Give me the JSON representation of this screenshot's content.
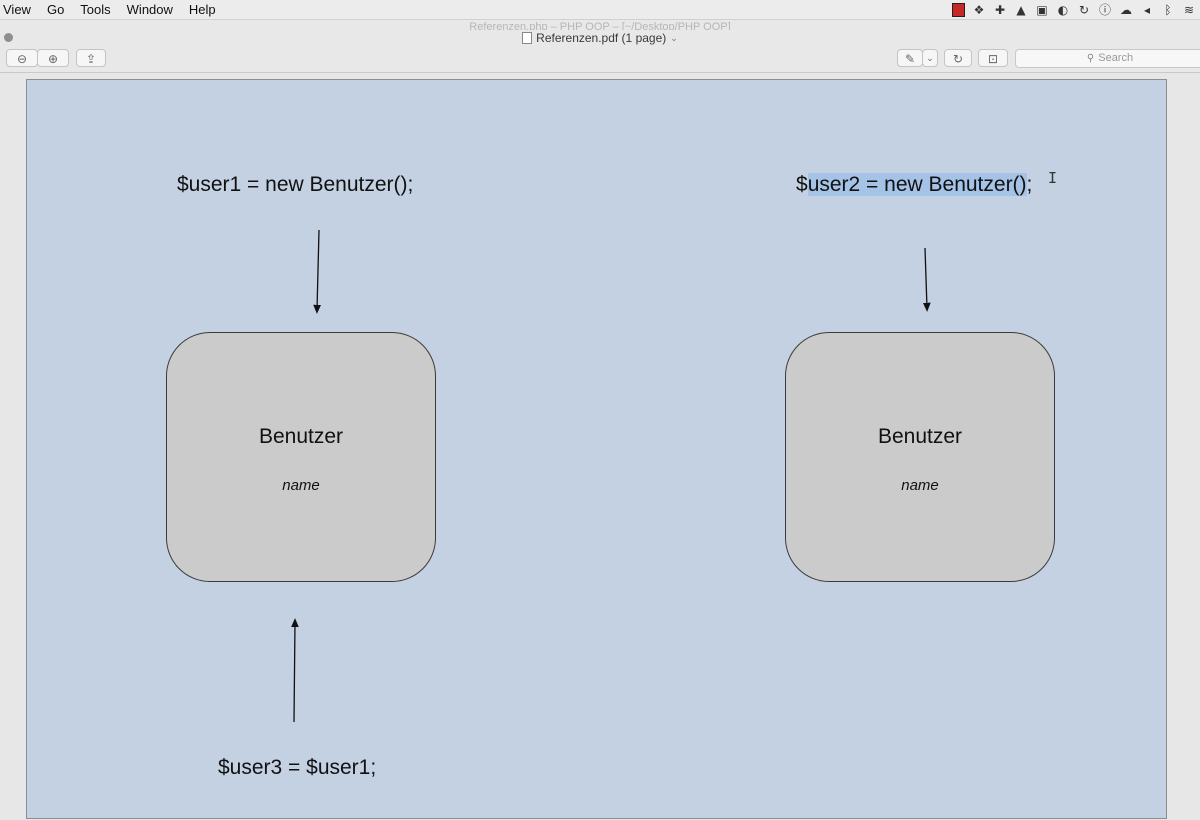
{
  "menubar": {
    "items": [
      "View",
      "Go",
      "Tools",
      "Window",
      "Help"
    ],
    "status_icons": [
      "red-square-icon",
      "dropbox-icon",
      "plus-icon",
      "triangle-icon",
      "square-icon",
      "evernote-icon",
      "refresh-icon",
      "info-icon",
      "cloud-icon",
      "volume-icon",
      "bluetooth-icon",
      "wifi-icon"
    ]
  },
  "window": {
    "ghost_title": "Referenzen.php – PHP OOP – [~/Desktop/PHP OOP]",
    "title": "Referenzen.pdf (1 page)"
  },
  "toolbar": {
    "zoom_out": "⊖",
    "zoom_in": "⊕",
    "share": "⇪",
    "markup": "✎",
    "markup_dropdown": "⌄",
    "rotate": "↻",
    "toolbox": "⊡",
    "search_placeholder": "Search"
  },
  "diagram": {
    "user1_decl": "$user1 = new Benutzer();",
    "user2_prefix": "$",
    "user2_selected": "user2 = new Benutzer()",
    "user2_suffix": ";",
    "user3_decl": "$user3 = $user1;",
    "box1": {
      "class_name": "Benutzer",
      "attribute": "name"
    },
    "box2": {
      "class_name": "Benutzer",
      "attribute": "name"
    },
    "colors": {
      "page_bg": "#c3d1e3",
      "box_fill": "#cbcbcb",
      "selection": "#a5c2e7"
    }
  }
}
